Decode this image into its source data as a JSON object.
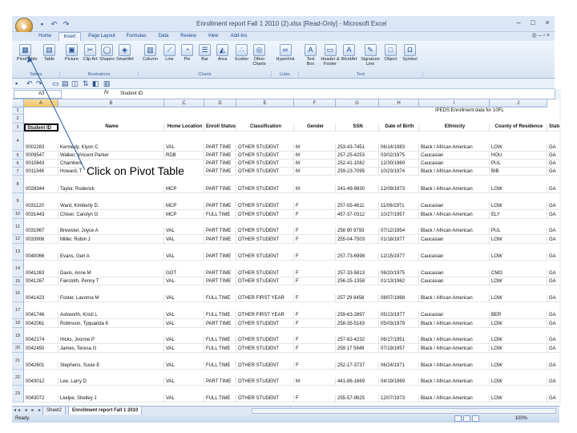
{
  "window": {
    "title": "Enrollment report Fall 1 2010 (2).xlsx [Read-Only] - Microsoft Excel",
    "controls": [
      "–",
      "□",
      "×"
    ]
  },
  "tabs": [
    "Home",
    "Insert",
    "Page Layout",
    "Formulas",
    "Data",
    "Review",
    "View",
    "Add-Ins"
  ],
  "ribbon": {
    "buttons": [
      "PivotTable",
      "Table",
      "Picture",
      "Clip Art",
      "Shapes",
      "SmartArt",
      "Column",
      "Line",
      "Pie",
      "Bar",
      "Area",
      "Scatter",
      "Other Charts",
      "Hyperlink",
      "Text Box",
      "Header & Footer",
      "WordArt",
      "Signature Line",
      "Object",
      "Symbol"
    ],
    "groups": [
      "Tables",
      "Illustrations",
      "Charts",
      "Links",
      "Text"
    ]
  },
  "formula_bar": {
    "name_box": "A3",
    "fx": "fx",
    "content": "Student ID"
  },
  "columns": [
    "A",
    "B",
    "C",
    "D",
    "E",
    "F",
    "G",
    "H",
    "I",
    "J"
  ],
  "sheet_title": "IPEDS Enrollment data for 10FL",
  "headers": [
    "Student ID",
    "Name",
    "Home Location",
    "Enroll Status",
    "Classification",
    "Gender",
    "SSN",
    "Date of Birth",
    "Ethnicity",
    "County of Residence",
    "State of"
  ],
  "rows": [
    {
      "n": "4",
      "c": [
        "0002283",
        "Kennedy, Kiyon C",
        "VAL",
        "PART TIME",
        "OTHER STUDENT",
        "M",
        "253-43-7451",
        "06/14/1983",
        "Black / African American",
        "LOW",
        "GA"
      ]
    },
    {
      "n": "5",
      "c": [
        "0009547",
        "Walker, Vincent Parker",
        "RDB",
        "PART TIME",
        "OTHER STUDENT",
        "M",
        "257-25-4253",
        "03/02/1975",
        "Caucasian",
        "HOU",
        "GA"
      ]
    },
    {
      "n": "6",
      "c": [
        "0010843",
        "Chambers",
        "",
        "PART TIME",
        "OTHER STUDENT",
        "M",
        "252-41-1082",
        "12/30/1969",
        "Caucasian",
        "PUL",
        "GA"
      ]
    },
    {
      "n": "7",
      "c": [
        "0011346",
        "Howard, T",
        "",
        "PART TIME",
        "OTHER STUDENT",
        "M",
        "259-23-7095",
        "10/23/1974",
        "Black / African American",
        "BIB",
        "GA"
      ]
    },
    {
      "n": "8",
      "c": [
        "0028344",
        "Taylor, Roderick",
        "MCP",
        "PART TIME",
        "OTHER STUDENT",
        "M",
        "241-49-9830",
        "12/09/1973",
        "Black / African American",
        "LOW",
        "GA"
      ]
    },
    {
      "n": "9",
      "c": [
        "0031120",
        "Ward, Kimberly D.",
        "MCP",
        "PART TIME",
        "OTHER STUDENT",
        "F",
        "257-55-4611",
        "11/06/1971",
        "Caucasian",
        "LOW",
        "GA"
      ]
    },
    {
      "n": "10",
      "c": [
        "0031443",
        "Chiser, Carolyn G",
        "MCP",
        "FULL TIME",
        "OTHER STUDENT",
        "F",
        "457-37-0312",
        "10/27/1957",
        "Black / African American",
        "ELY",
        "GA"
      ]
    },
    {
      "n": "11",
      "c": [
        "0031967",
        "Brewster, Joyce A",
        "VAL",
        "PART TIME",
        "OTHER STUDENT",
        "F",
        "258 90 9793",
        "07/12/1954",
        "Black / African American",
        "PUL",
        "GA"
      ]
    },
    {
      "n": "12",
      "c": [
        "0033906",
        "Miller, Robin J",
        "VAL",
        "PART TIME",
        "OTHER STUDENT",
        "F",
        "255-04-7503",
        "01/18/1977",
        "Caucasian",
        "LOW",
        "GA"
      ]
    },
    {
      "n": "13",
      "c": [
        "0040066",
        "Evans, Gerl A",
        "VAL",
        "PART TIME",
        "OTHER STUDENT",
        "F",
        "257-73-6998",
        "12/15/1977",
        "Caucasian",
        "LOW",
        "GA"
      ]
    },
    {
      "n": "14",
      "c": [
        "0041263",
        "Davis, Anne M",
        "GOT",
        "PART TIME",
        "OTHER STUDENT",
        "F",
        "257-33-5813",
        "06/20/1975",
        "Caucasian",
        "CMG",
        "GA"
      ]
    },
    {
      "n": "15",
      "c": [
        "0041267",
        "Faircloth, Penny T",
        "VAL",
        "PART TIME",
        "OTHER STUDENT",
        "F",
        "256-25-1358",
        "01/13/1962",
        "Caucasian",
        "LOW",
        "GA"
      ]
    },
    {
      "n": "16",
      "c": [
        "0041423",
        "Foster, Lavorna M",
        "VAL",
        "FULL TIME",
        "OTHER FIRST YEAR",
        "F",
        "257 29 8458",
        "08/07/1968",
        "Black / African American",
        "LOW",
        "GA"
      ]
    },
    {
      "n": "17",
      "c": [
        "0041746",
        "Ashworth, Kristi L",
        "VAL",
        "FULL TIME",
        "OTHER FIRST YEAR",
        "F",
        "259-63-2897",
        "05/13/1977",
        "Caucasian",
        "BER",
        "GA"
      ]
    },
    {
      "n": "18",
      "c": [
        "0042061",
        "Robinson, Tyquanda K",
        "VAL",
        "PART TIME",
        "OTHER STUDENT",
        "F",
        "258-35-5183",
        "05/03/1979",
        "Black / African American",
        "LOW",
        "GA"
      ]
    },
    {
      "n": "19",
      "c": [
        "0042174",
        "Hicks, Jvonne P",
        "VAL",
        "FULL TIME",
        "OTHER STUDENT",
        "F",
        "257-82-4232",
        "06/17/1951",
        "Black / African American",
        "LOW",
        "GA"
      ]
    },
    {
      "n": "20",
      "c": [
        "0042450",
        "James, Teresa G",
        "VAL",
        "FULL TIME",
        "OTHER STUDENT",
        "F",
        "259 17 5849",
        "07/19/1957",
        "Black / African American",
        "LOW",
        "GA"
      ]
    },
    {
      "n": "21",
      "c": [
        "0042601",
        "Stephens, Susie E",
        "VAL",
        "FULL TIME",
        "OTHER STUDENT",
        "F",
        "252-17-3737",
        "06/24/1971",
        "Black / African American",
        "LOW",
        "GA"
      ]
    },
    {
      "n": "22",
      "c": [
        "0043012",
        "Lee, Larry D",
        "VAL",
        "PART TIME",
        "OTHER STUDENT",
        "M",
        "441-86-1669",
        "04/19/1969",
        "Black / African American",
        "LOW",
        "GA"
      ]
    },
    {
      "n": "23",
      "c": [
        "0043072",
        "Lkelpe, Shelley J",
        "VAL",
        "FULL TIME",
        "OTHER STUDENT",
        "F",
        "255-57-9625",
        "12/07/1973",
        "Black / African American",
        "LOW",
        "GA"
      ]
    }
  ],
  "callout": "Click on Pivot Table",
  "sheet_tabs": [
    "Sheet2",
    "Enrollment report Fall 1 2010"
  ],
  "status": {
    "ready": "Ready",
    "zoom": "100%"
  }
}
